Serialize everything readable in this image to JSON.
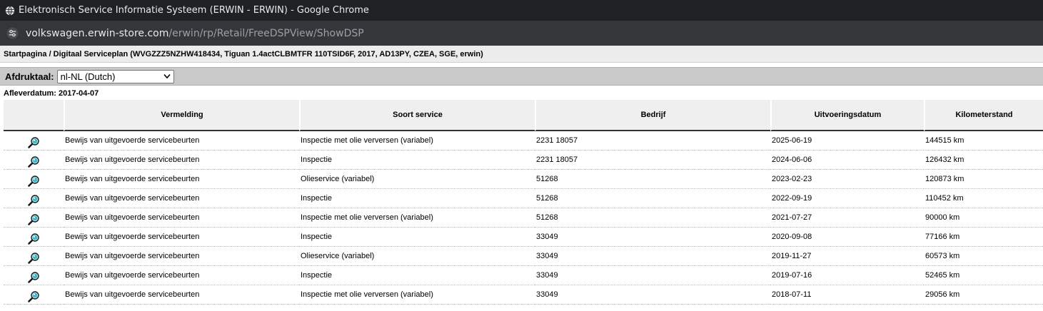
{
  "window": {
    "title": "Elektronisch Service Informatie Systeem (ERWIN - ERWIN) - Google Chrome",
    "url_host": "volkswagen.erwin-store.com",
    "url_path": "/erwin/rp/Retail/FreeDSPView/ShowDSP",
    "globe_icon": "globe-icon",
    "site_info_icon": "tune-icon"
  },
  "breadcrumb": "Startpagina / Digitaal Serviceplan (WVGZZZ5NZHW418434, Tiguan 1.4actCLBMTFR 110TSID6F, 2017, AD13PY, CZEA, SGE, erwin)",
  "print_language": {
    "label": "Afdruktaal:",
    "selected": "nl-NL (Dutch)"
  },
  "delivery_date": "Afleverdatum: 2017-04-07",
  "table": {
    "headers": [
      "Vermelding",
      "Soort service",
      "Bedrijf",
      "Uitvoeringsdatum",
      "Kilometerstand"
    ],
    "view_icon": "magnifier-icon",
    "rows": [
      {
        "vermelding": "Bewijs van uitgevoerde servicebeurten",
        "soort": "Inspectie met olie verversen (variabel)",
        "bedrijf": "2231 18057",
        "datum": "2025-06-19",
        "km": "144515 km"
      },
      {
        "vermelding": "Bewijs van uitgevoerde servicebeurten",
        "soort": "Inspectie",
        "bedrijf": "2231 18057",
        "datum": "2024-06-06",
        "km": "126432 km"
      },
      {
        "vermelding": "Bewijs van uitgevoerde servicebeurten",
        "soort": "Olieservice (variabel)",
        "bedrijf": "51268",
        "datum": "2023-02-23",
        "km": "120873 km"
      },
      {
        "vermelding": "Bewijs van uitgevoerde servicebeurten",
        "soort": "Inspectie",
        "bedrijf": "51268",
        "datum": "2022-09-19",
        "km": "110452 km"
      },
      {
        "vermelding": "Bewijs van uitgevoerde servicebeurten",
        "soort": "Inspectie met olie verversen (variabel)",
        "bedrijf": "51268",
        "datum": "2021-07-27",
        "km": "90000 km"
      },
      {
        "vermelding": "Bewijs van uitgevoerde servicebeurten",
        "soort": "Inspectie",
        "bedrijf": "33049",
        "datum": "2020-09-08",
        "km": "77166 km"
      },
      {
        "vermelding": "Bewijs van uitgevoerde servicebeurten",
        "soort": "Olieservice (variabel)",
        "bedrijf": "33049",
        "datum": "2019-11-27",
        "km": "60573 km"
      },
      {
        "vermelding": "Bewijs van uitgevoerde servicebeurten",
        "soort": "Inspectie",
        "bedrijf": "33049",
        "datum": "2019-07-16",
        "km": "52465 km"
      },
      {
        "vermelding": "Bewijs van uitgevoerde servicebeurten",
        "soort": "Inspectie met olie verversen (variabel)",
        "bedrijf": "33049",
        "datum": "2018-07-11",
        "km": "29056 km"
      }
    ]
  },
  "colors": {
    "titlebar_bg": "#202124",
    "addrbar_bg": "#35363a",
    "langbar_bg": "#c9c9c9",
    "header_bg": "#efefef",
    "magnifier_lens": "#3fb8c8"
  }
}
